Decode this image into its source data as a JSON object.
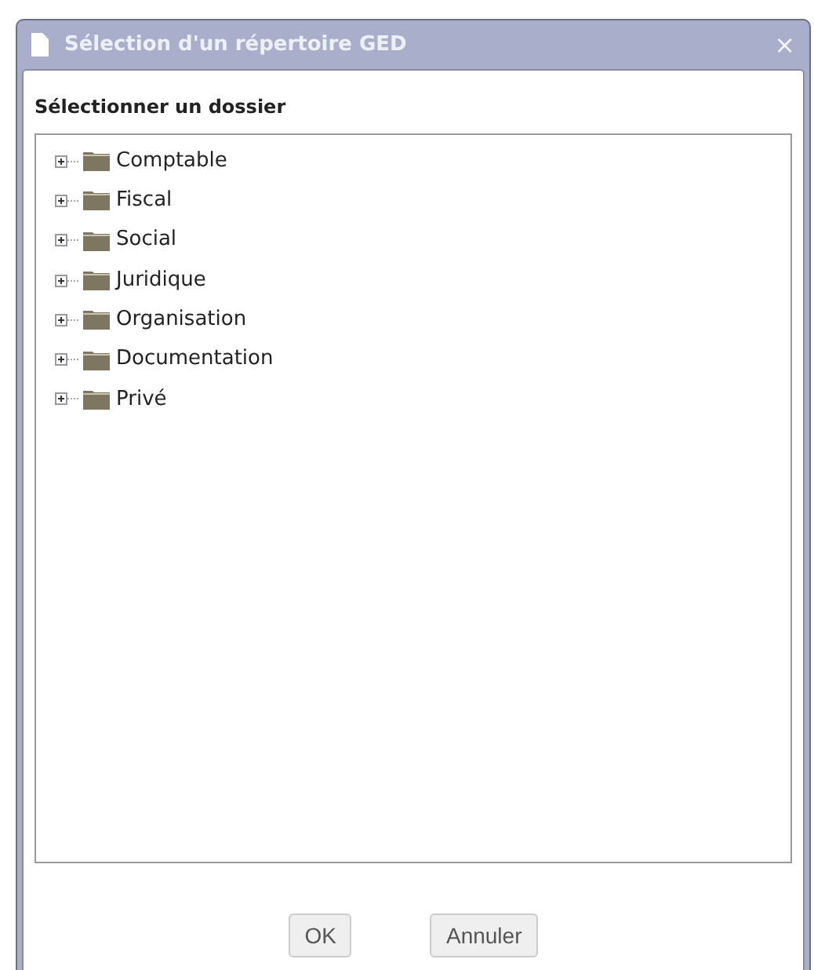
{
  "window": {
    "title": "Sélection d'un répertoire GED",
    "close": "×"
  },
  "heading": "Sélectionner un dossier",
  "tree": {
    "items": [
      {
        "label": "Comptable",
        "expanded": false
      },
      {
        "label": "Fiscal",
        "expanded": false
      },
      {
        "label": "Social",
        "expanded": false
      },
      {
        "label": "Juridique",
        "expanded": false
      },
      {
        "label": "Organisation",
        "expanded": false
      },
      {
        "label": "Documentation",
        "expanded": false
      },
      {
        "label": "Privé",
        "expanded": false
      }
    ]
  },
  "buttons": [
    "OK",
    "Annuler"
  ]
}
